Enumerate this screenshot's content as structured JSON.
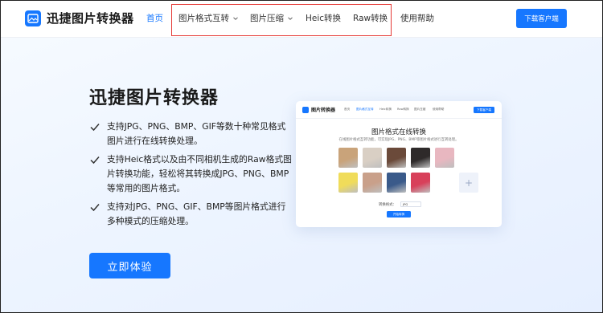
{
  "header": {
    "logo_text": "迅捷图片转换器",
    "nav": [
      {
        "label": "首页",
        "active": true,
        "dropdown": false
      },
      {
        "label": "图片格式互转",
        "active": false,
        "dropdown": true
      },
      {
        "label": "图片压缩",
        "active": false,
        "dropdown": true
      },
      {
        "label": "Heic转换",
        "active": false,
        "dropdown": false
      },
      {
        "label": "Raw转换",
        "active": false,
        "dropdown": false
      },
      {
        "label": "使用帮助",
        "active": false,
        "dropdown": false
      }
    ],
    "download_label": "下载客户端"
  },
  "hero": {
    "title": "迅捷图片转换器",
    "features": [
      "支持JPG、PNG、BMP、GIF等数十种常见格式图片进行在线转换处理。",
      "支持Heic格式以及由不同相机生成的Raw格式图片转换功能，轻松将其转换成JPG、PNG、BMP等常用的图片格式。",
      "支持对JPG、PNG、GIF、BMP等图片格式进行多种模式的压缩处理。"
    ],
    "cta_label": "立即体验"
  },
  "preview": {
    "logo_text": "图片转换器",
    "nav": [
      "首页",
      "图片格式互转",
      "Heic转换",
      "Raw转换",
      "图片压缩",
      "使用帮助"
    ],
    "download_label": "下载客户端",
    "title": "图片格式在线转换",
    "subtitle": "在线图片格式互转功能，可实现JPG、PNG、BMP等图片格式进行互转处理。",
    "format_label": "转换格式：",
    "format_value": "JPG",
    "start_label": "开始转换",
    "add_symbol": "+"
  },
  "colors": {
    "accent": "#1677ff",
    "highlight_border": "#e53935",
    "thumb_colors": [
      "#c9a37a",
      "#d9cfc4",
      "#6b4a3a",
      "#2e2a2a",
      "#e8b7c0",
      "#f0dc5a",
      "#c9a08a",
      "#3a5a8a",
      "#d8405a",
      "#cfd6e6"
    ]
  }
}
